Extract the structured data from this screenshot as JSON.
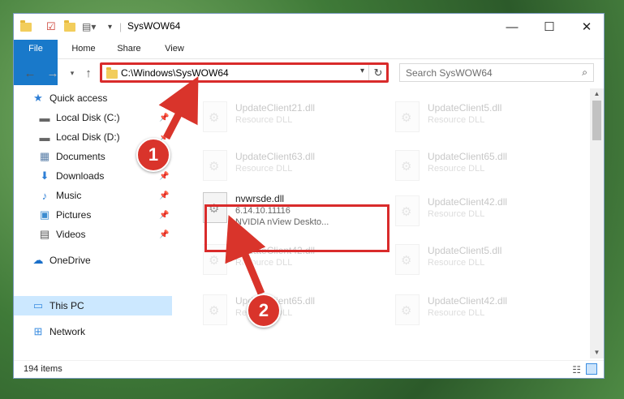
{
  "window": {
    "title": "SysWOW64",
    "controls": {
      "minimize": "—",
      "maximize": "☐",
      "close": "✕"
    }
  },
  "ribbon": {
    "tabs": [
      "File",
      "Home",
      "Share",
      "View"
    ]
  },
  "address": {
    "path": "C:\\Windows\\SysWOW64"
  },
  "search": {
    "placeholder": "Search SysWOW64"
  },
  "nav_pane": {
    "items": [
      {
        "label": "Quick access",
        "icon": "star-icon"
      },
      {
        "label": "Local Disk (C:)",
        "icon": "drive-icon",
        "pinned": true
      },
      {
        "label": "Local Disk (D:)",
        "icon": "drive-icon",
        "pinned": true
      },
      {
        "label": "Documents",
        "icon": "documents-icon",
        "pinned": true
      },
      {
        "label": "Downloads",
        "icon": "download-icon",
        "pinned": true
      },
      {
        "label": "Music",
        "icon": "music-icon",
        "pinned": true
      },
      {
        "label": "Pictures",
        "icon": "pictures-icon",
        "pinned": true
      },
      {
        "label": "Videos",
        "icon": "videos-icon",
        "pinned": true
      },
      {
        "label": "OneDrive",
        "icon": "cloud-icon"
      },
      {
        "label": "This PC",
        "icon": "computer-icon",
        "selected": true
      },
      {
        "label": "Network",
        "icon": "network-icon"
      }
    ]
  },
  "files": [
    {
      "name": "UpdateClient21.dll",
      "desc": "Resource DLL"
    },
    {
      "name": "UpdateClient5.dll",
      "desc": "Resource DLL"
    },
    {
      "name": "UpdateClient63.dll",
      "desc": "Resource DLL"
    },
    {
      "name": "UpdateClient65.dll",
      "desc": "Resource DLL"
    },
    {
      "name": "nvwrsde.dll",
      "desc": "6.14.10.11116",
      "desc2": "NVIDIA nView Deskto..."
    },
    {
      "name": "UpdateClient42.dll",
      "desc": "Resource DLL"
    },
    {
      "name": "UpdateClient42.dll",
      "desc": "Resource DLL"
    },
    {
      "name": "UpdateClient5.dll",
      "desc": "Resource DLL"
    },
    {
      "name": "UpdateClient65.dll",
      "desc": "Resource DLL"
    },
    {
      "name": "UpdateClient42.dll",
      "desc": "Resource DLL"
    }
  ],
  "status": {
    "item_count": "194 items"
  },
  "annotations": {
    "step1": "1",
    "step2": "2",
    "color": "#d9342b"
  }
}
